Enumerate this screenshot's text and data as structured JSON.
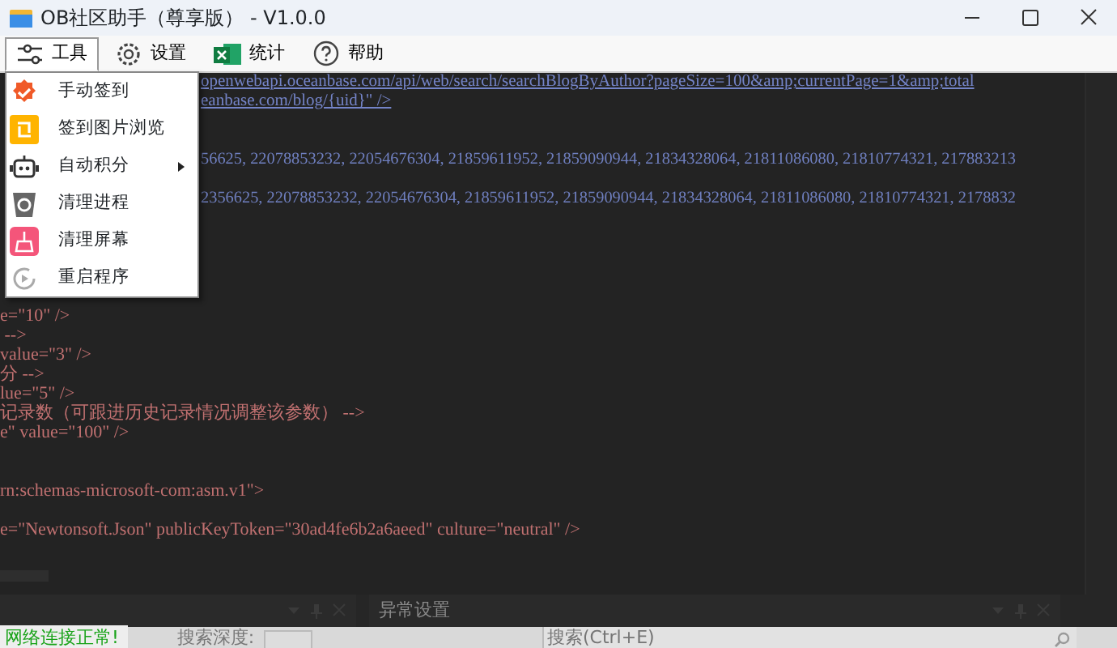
{
  "window": {
    "title": "OB社区助手（尊享版） - V1.0.0"
  },
  "menubar": [
    {
      "label": "工具",
      "kind": "tools",
      "selected": true
    },
    {
      "label": "设置",
      "kind": "gear",
      "selected": false
    },
    {
      "label": "统计",
      "kind": "sheet",
      "selected": false
    },
    {
      "label": "帮助",
      "kind": "help",
      "selected": false
    }
  ],
  "dropdown": [
    {
      "label": "手动签到",
      "kind": "badge",
      "submenu": false
    },
    {
      "label": "签到图片浏览",
      "kind": "swap",
      "submenu": false
    },
    {
      "label": "自动积分",
      "kind": "robot",
      "submenu": true
    },
    {
      "label": "清理进程",
      "kind": "bin",
      "submenu": false
    },
    {
      "label": "清理屏幕",
      "kind": "broom",
      "submenu": false
    },
    {
      "label": "重启程序",
      "kind": "restart",
      "submenu": false
    }
  ],
  "editor": {
    "lines": [
      {
        "kind": "link",
        "text": "openwebapi.oceanbase.com/api/web/search/searchBlogByAuthor?pageSize=100&amp;currentPage=1&amp;total"
      },
      {
        "kind": "link",
        "text": "eanbase.com/blog/{uid}\" />"
      },
      {
        "kind": "blank"
      },
      {
        "kind": "blank"
      },
      {
        "kind": "side",
        "text": "56625, 22078853232, 22054676304, 21859611952, 21859090944, 21834328064, 21811086080, 21810774321, 217883213"
      },
      {
        "kind": "blank"
      },
      {
        "kind": "side",
        "text": "2356625, 22078853232, 22054676304, 21859611952, 21859090944, 21834328064, 21811086080, 21810774321, 2178832"
      },
      {
        "kind": "blank"
      },
      {
        "kind": "blank"
      },
      {
        "kind": "blank"
      },
      {
        "kind": "blank"
      },
      {
        "kind": "blank"
      },
      {
        "kind": "code",
        "text": "e=\"10\" />"
      },
      {
        "kind": "code",
        "text": " -->"
      },
      {
        "kind": "code",
        "text": "value=\"3\" />"
      },
      {
        "kind": "code",
        "text": "分 -->"
      },
      {
        "kind": "code",
        "text": "lue=\"5\" />"
      },
      {
        "kind": "code",
        "text": "记录数（可跟进历史记录情况调整该参数） -->"
      },
      {
        "kind": "code",
        "text": "e\" value=\"100\" />"
      },
      {
        "kind": "blank"
      },
      {
        "kind": "blank"
      },
      {
        "kind": "code",
        "text": "rn:schemas-microsoft-com:asm.v1\">"
      },
      {
        "kind": "blank"
      },
      {
        "kind": "code",
        "text": "e=\"Newtonsoft.Json\" publicKeyToken=\"30ad4fe6b2a6aeed\" culture=\"neutral\" />"
      }
    ]
  },
  "panels": [
    {
      "kind": "untitled"
    },
    {
      "kind": "titled",
      "title": "异常设置"
    }
  ],
  "status": {
    "message": "网络连接正常!",
    "depth_label": "搜索深度:",
    "search_placeholder": "搜索(Ctrl+E)"
  }
}
